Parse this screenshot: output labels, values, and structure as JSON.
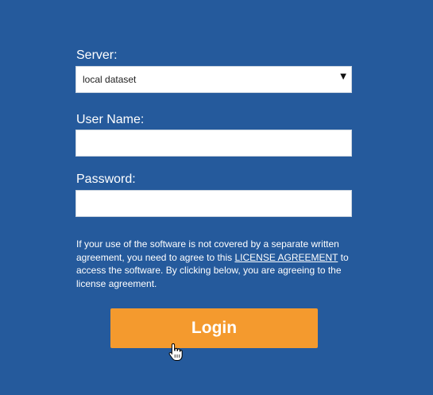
{
  "form": {
    "server_label": "Server:",
    "server_value": "local dataset",
    "server_arrow": "▼",
    "username_label": "User Name:",
    "username_value": "",
    "password_label": "Password:",
    "password_value": ""
  },
  "notice": {
    "text_before": "If your use of the software is not covered by a separate written agreement, you need to agree to this ",
    "link_text": "LICENSE AGREEMENT",
    "text_after": " to access the software. By clicking below, you are agreeing to the license agreement."
  },
  "login_button": {
    "label": "Login"
  },
  "colors": {
    "background": "#255a9c",
    "button": "#f49a2e",
    "text": "#ffffff"
  },
  "icons": {
    "cursor": "hand-pointer-icon",
    "dropdown": "dropdown-arrow-icon"
  }
}
